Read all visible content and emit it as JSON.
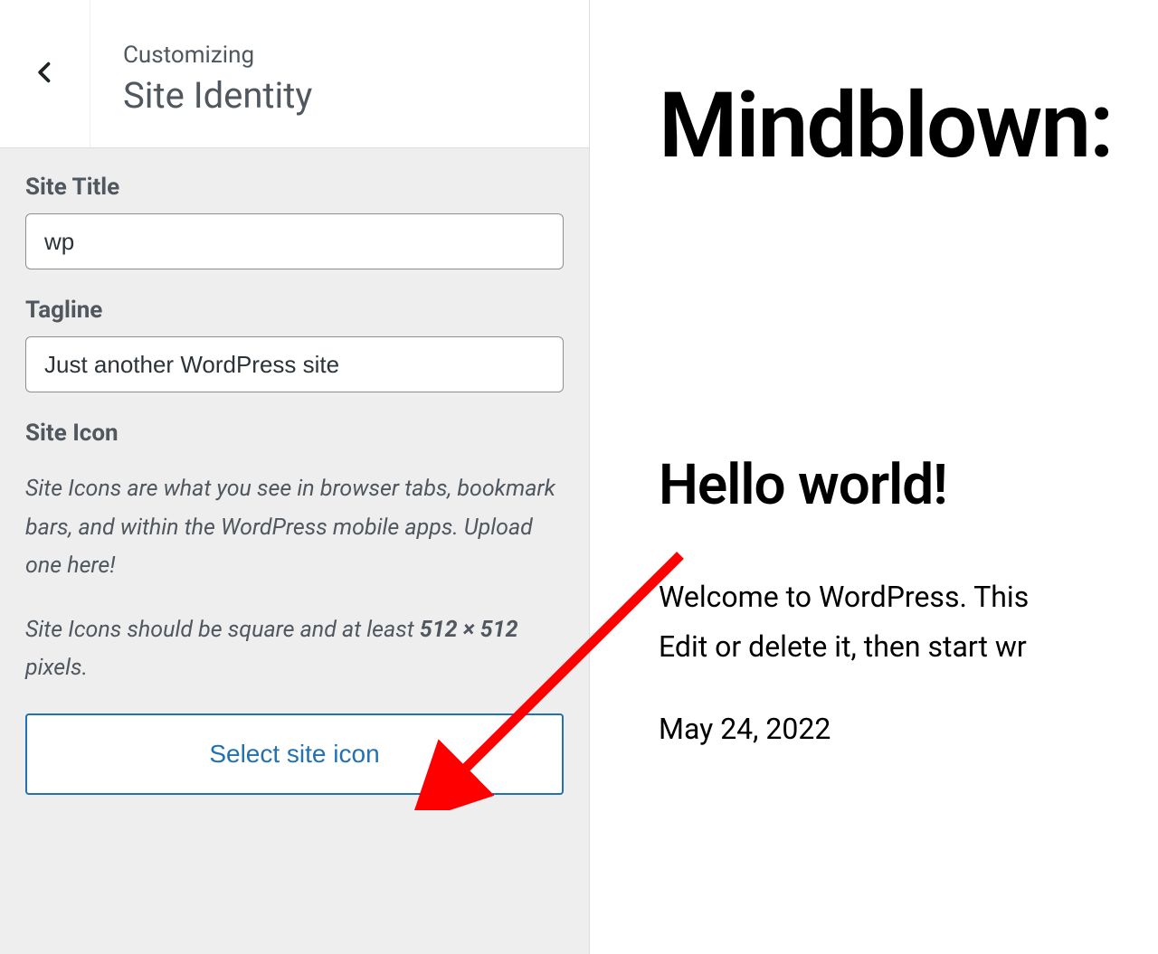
{
  "header": {
    "breadcrumb": "Customizing",
    "title": "Site Identity"
  },
  "fields": {
    "site_title": {
      "label": "Site Title",
      "value": "wp"
    },
    "tagline": {
      "label": "Tagline",
      "value": "Just another WordPress site"
    }
  },
  "site_icon": {
    "label": "Site Icon",
    "desc1": "Site Icons are what you see in browser tabs, bookmark bars, and within the WordPress mobile apps. Upload one here!",
    "desc2_prefix": "Site Icons should be square and at least ",
    "desc2_bold": "512 × 512",
    "desc2_suffix": " pixels.",
    "button": "Select site icon"
  },
  "preview": {
    "heading": "Mindblown:",
    "post_title": "Hello world!",
    "post_body_line1": "Welcome to WordPress. This ",
    "post_body_line2": "Edit or delete it, then start wr",
    "post_date": "May 24, 2022"
  }
}
